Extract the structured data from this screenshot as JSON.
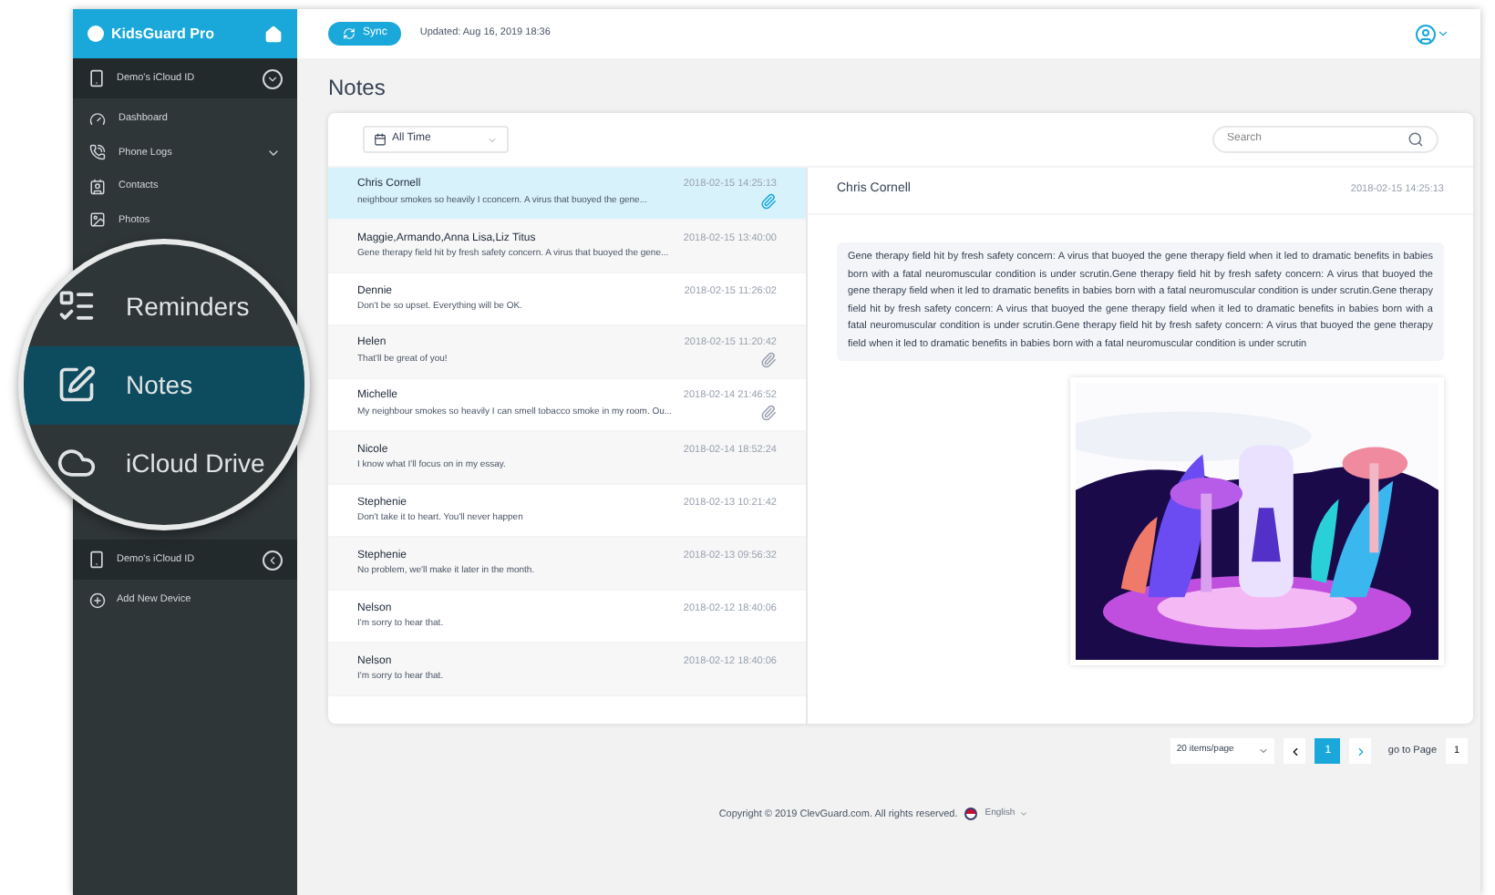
{
  "sidebar": {
    "brand": "KidsGuard Pro",
    "device": {
      "name": "Demo's iCloud ID",
      "expanded": true
    },
    "items": [
      {
        "label": "Dashboard",
        "has_children": false
      },
      {
        "label": "Phone Logs",
        "has_children": true
      },
      {
        "label": "Contacts",
        "has_children": false
      },
      {
        "label": "Photos",
        "has_children": false
      }
    ],
    "second_device": {
      "name": "Demo's iCloud ID",
      "expanded": false
    },
    "add_device": "Add New Device"
  },
  "magnifier": {
    "items": [
      {
        "label": "Reminders",
        "selected": false
      },
      {
        "label": "Notes",
        "selected": true
      },
      {
        "label": "iCloud Drive",
        "selected": false
      }
    ]
  },
  "topbar": {
    "sync": "Sync",
    "updated": "Updated: Aug 16, 2019 18:36"
  },
  "page_title": "Notes",
  "filter": "All Time",
  "search": {
    "placeholder": "Search"
  },
  "notes": [
    {
      "name": "Chris Cornell",
      "time": "2018-02-15 14:25:13",
      "preview": "neighbour smokes so heavily I cconcern. A virus that buoyed the gene...",
      "attachment": true,
      "selected": true
    },
    {
      "name": "Maggie,Armando,Anna Lisa,Liz Titus",
      "time": "2018-02-15 13:40:00",
      "preview": "Gene therapy field hit by fresh safety concern. A virus that buoyed the gene...",
      "attachment": false,
      "selected": false
    },
    {
      "name": "Dennie",
      "time": "2018-02-15 11:26:02",
      "preview": "Don't be so upset. Everything will be OK.",
      "attachment": false,
      "selected": false
    },
    {
      "name": "Helen",
      "time": "2018-02-15 11:20:42",
      "preview": "That'll be great of you!",
      "attachment": true,
      "selected": false
    },
    {
      "name": "Michelle",
      "time": "2018-02-14 21:46:52",
      "preview": "My neighbour smokes so heavily I can smell tobacco smoke in my room. Ou...",
      "attachment": true,
      "selected": false
    },
    {
      "name": "Nicole",
      "time": "2018-02-14 18:52:24",
      "preview": "I know what I'll focus on in my essay.",
      "attachment": false,
      "selected": false
    },
    {
      "name": "Stephenie",
      "time": "2018-02-13 10:21:42",
      "preview": "Don't take it to heart. You'll never happen",
      "attachment": false,
      "selected": false
    },
    {
      "name": "Stephenie",
      "time": "2018-02-13 09:56:32",
      "preview": "No problem, we'll make it later in the month.",
      "attachment": false,
      "selected": false
    },
    {
      "name": "Nelson",
      "time": "2018-02-12 18:40:06",
      "preview": "I'm sorry to hear that.",
      "attachment": false,
      "selected": false
    },
    {
      "name": "Nelson",
      "time": "2018-02-12 18:40:06",
      "preview": "I'm sorry to hear that.",
      "attachment": false,
      "selected": false
    }
  ],
  "detail": {
    "name": "Chris Cornell",
    "time": "2018-02-15 14:25:13",
    "body": "Gene therapy field hit by fresh safety concern: A virus that buoyed the gene therapy field when it led to dramatic benefits in babies born with a fatal neuromuscular condition is under scrutin.Gene therapy field hit by fresh safety concern: A virus that buoyed the gene therapy field when it led to dramatic benefits in babies born with a fatal neuromuscular condition is under scrutin.Gene therapy field hit by fresh safety concern: A virus that buoyed the gene therapy field when it led to dramatic benefits in babies born with a fatal neuromuscular condition is under scrutin.Gene therapy field hit by fresh safety concern: A virus that buoyed the gene therapy field when it led to dramatic benefits in babies born with a fatal neuromuscular condition is under scrutin"
  },
  "pagination": {
    "page_size": "20 items/page",
    "pages": [
      {
        "label": "1",
        "selected": true
      }
    ],
    "goto_label": "go to Page",
    "goto_value": "1"
  },
  "footer": {
    "copyright": "Copyright © 2019 ClevGuard.com. All rights reserved.",
    "language": "English"
  }
}
